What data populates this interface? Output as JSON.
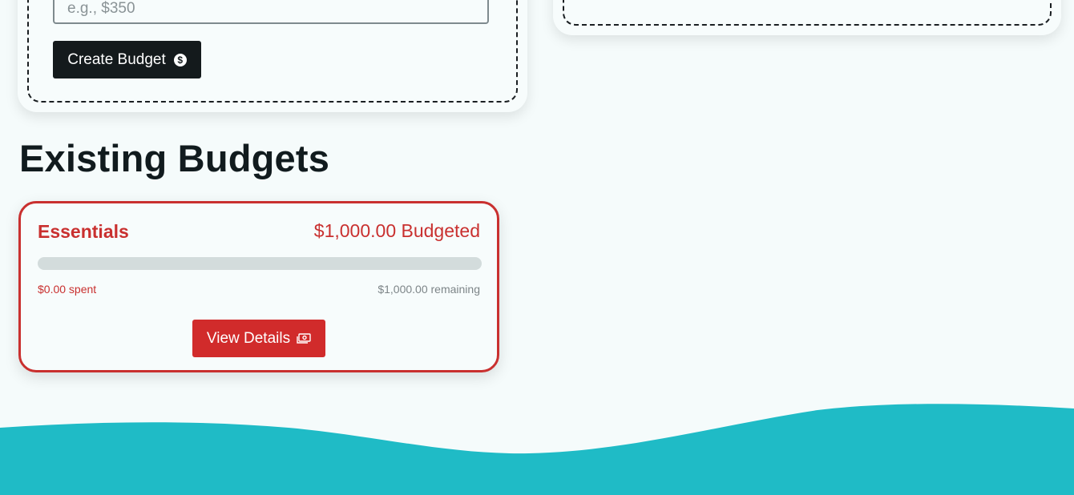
{
  "create_form": {
    "amount_placeholder": "e.g., $350",
    "create_button_label": "Create Budget",
    "create_button_icon": "dollar-circle-icon"
  },
  "existing_budgets": {
    "title": "Existing Budgets",
    "items": [
      {
        "name": "Essentials",
        "budgeted_text": "$1,000.00 Budgeted",
        "spent_text": "$0.00 spent",
        "remaining_text": "$1,000.00 remaining",
        "progress_percent": 0,
        "view_button_label": "View Details",
        "view_button_icon": "cash-icon",
        "accent_color": "#c9302f"
      }
    ]
  },
  "theme": {
    "background": "#f5fbfb",
    "dark": "#141a1c",
    "wave_color": "#1fbbc6",
    "danger": "#d12b2b"
  }
}
